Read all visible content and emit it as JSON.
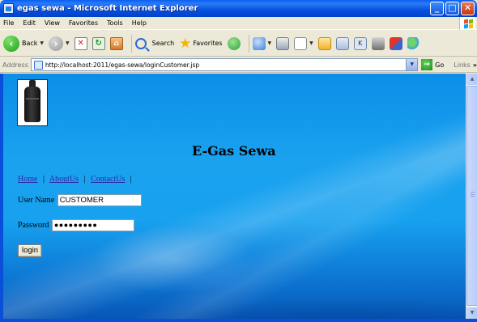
{
  "window": {
    "title": "egas sewa - Microsoft Internet Explorer",
    "controls": [
      "minimize",
      "maximize",
      "close"
    ]
  },
  "menu": {
    "items": [
      "File",
      "Edit",
      "View",
      "Favorites",
      "Tools",
      "Help"
    ]
  },
  "toolbar": {
    "back_label": "Back",
    "search_label": "Search",
    "favorites_label": "Favorites"
  },
  "address": {
    "label": "Address",
    "url": "http://localhost:2011/egas-sewa/loginCustomer.jsp",
    "go_label": "Go",
    "links_label": "Links"
  },
  "page": {
    "site_title": "E-Gas Sewa",
    "nav": {
      "home": "Home",
      "about": "AboutUs",
      "contact": "ContactUs",
      "separator": "|"
    },
    "form": {
      "username_label": "User Name",
      "username_value": "CUSTOMER",
      "password_label": "Password",
      "password_value": "●●●●●●●●●",
      "login_label": "login"
    }
  },
  "colors": {
    "titlebar": "#0550e0",
    "page_background": "#17a1ef",
    "link": "#2a2aa8"
  }
}
